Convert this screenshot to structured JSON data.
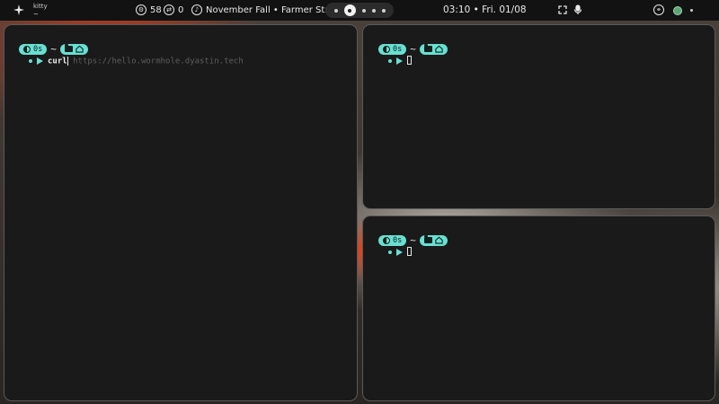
{
  "topbar": {
    "app_name": "kitty",
    "app_sub": "~",
    "cpu_value": "58",
    "sync_value": "0",
    "media_title": "November Fall • Farmer Str...",
    "workspaces": 5,
    "active_workspace": 1,
    "clock": "03:10 • Fri. 01/08"
  },
  "terminals": [
    {
      "badge_time": "0s",
      "dir": "~",
      "command": "curl",
      "suggestion": " https://hello.wormhole.dyastin.tech"
    },
    {
      "badge_time": "0s",
      "dir": "~",
      "command": "",
      "suggestion": ""
    },
    {
      "badge_time": "0s",
      "dir": "~",
      "command": "",
      "suggestion": ""
    }
  ],
  "colors": {
    "accent": "#68e0d2",
    "terminal_bg": "#1a1a1a",
    "bar_bg": "#121212"
  },
  "icons": [
    "sparkle-icon",
    "cpu-icon",
    "sync-icon",
    "music-note-icon",
    "fullscreen-icon",
    "microphone-icon",
    "steam-icon",
    "status-dot-icon",
    "dot-menu-icon"
  ]
}
